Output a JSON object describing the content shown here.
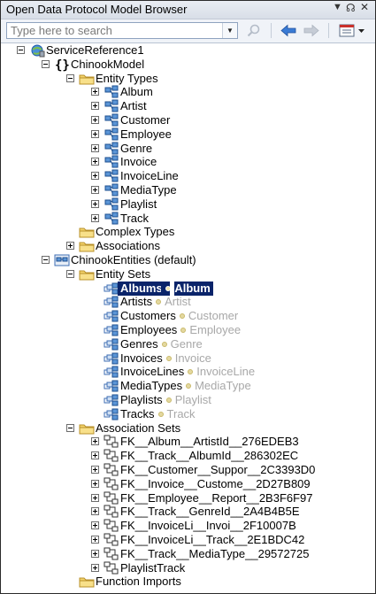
{
  "window": {
    "title": "Open Data Protocol Model Browser"
  },
  "toolbar": {
    "search_placeholder": "Type here to search"
  },
  "tree": [
    {
      "label": "ServiceReference1",
      "icon": "service-reference-icon",
      "level": 0,
      "expander": "minus"
    },
    {
      "label": "ChinookModel",
      "icon": "namespace-braces-icon",
      "level": 1,
      "expander": "minus"
    },
    {
      "label": "Entity Types",
      "icon": "folder-icon",
      "level": 2,
      "expander": "minus"
    },
    {
      "label": "Album",
      "icon": "entity-type-icon",
      "level": 3,
      "expander": "plus"
    },
    {
      "label": "Artist",
      "icon": "entity-type-icon",
      "level": 3,
      "expander": "plus"
    },
    {
      "label": "Customer",
      "icon": "entity-type-icon",
      "level": 3,
      "expander": "plus"
    },
    {
      "label": "Employee",
      "icon": "entity-type-icon",
      "level": 3,
      "expander": "plus"
    },
    {
      "label": "Genre",
      "icon": "entity-type-icon",
      "level": 3,
      "expander": "plus"
    },
    {
      "label": "Invoice",
      "icon": "entity-type-icon",
      "level": 3,
      "expander": "plus"
    },
    {
      "label": "InvoiceLine",
      "icon": "entity-type-icon",
      "level": 3,
      "expander": "plus"
    },
    {
      "label": "MediaType",
      "icon": "entity-type-icon",
      "level": 3,
      "expander": "plus"
    },
    {
      "label": "Playlist",
      "icon": "entity-type-icon",
      "level": 3,
      "expander": "plus"
    },
    {
      "label": "Track",
      "icon": "entity-type-icon",
      "level": 3,
      "expander": "plus"
    },
    {
      "label": "Complex Types",
      "icon": "folder-icon",
      "level": 2,
      "expander": "none"
    },
    {
      "label": "Associations",
      "icon": "folder-icon",
      "level": 2,
      "expander": "plus"
    },
    {
      "label": "ChinookEntities (default)",
      "icon": "entity-container-icon",
      "level": 1,
      "expander": "minus"
    },
    {
      "label": "Entity Sets",
      "icon": "folder-icon",
      "level": 2,
      "expander": "minus"
    },
    {
      "label": "Albums",
      "type": "Album",
      "icon": "entity-set-icon",
      "level": 3,
      "expander": "none",
      "selected": true
    },
    {
      "label": "Artists",
      "type": "Artist",
      "icon": "entity-set-icon",
      "level": 3,
      "expander": "none"
    },
    {
      "label": "Customers",
      "type": "Customer",
      "icon": "entity-set-icon",
      "level": 3,
      "expander": "none"
    },
    {
      "label": "Employees",
      "type": "Employee",
      "icon": "entity-set-icon",
      "level": 3,
      "expander": "none"
    },
    {
      "label": "Genres",
      "type": "Genre",
      "icon": "entity-set-icon",
      "level": 3,
      "expander": "none"
    },
    {
      "label": "Invoices",
      "type": "Invoice",
      "icon": "entity-set-icon",
      "level": 3,
      "expander": "none"
    },
    {
      "label": "InvoiceLines",
      "type": "InvoiceLine",
      "icon": "entity-set-icon",
      "level": 3,
      "expander": "none"
    },
    {
      "label": "MediaTypes",
      "type": "MediaType",
      "icon": "entity-set-icon",
      "level": 3,
      "expander": "none"
    },
    {
      "label": "Playlists",
      "type": "Playlist",
      "icon": "entity-set-icon",
      "level": 3,
      "expander": "none"
    },
    {
      "label": "Tracks",
      "type": "Track",
      "icon": "entity-set-icon",
      "level": 3,
      "expander": "none"
    },
    {
      "label": "Association Sets",
      "icon": "folder-icon",
      "level": 2,
      "expander": "minus"
    },
    {
      "label": "FK__Album__ArtistId__276EDEB3",
      "icon": "association-set-icon",
      "level": 3,
      "expander": "plus"
    },
    {
      "label": "FK__Track__AlbumId__286302EC",
      "icon": "association-set-icon",
      "level": 3,
      "expander": "plus"
    },
    {
      "label": "FK__Customer__Suppor__2C3393D0",
      "icon": "association-set-icon",
      "level": 3,
      "expander": "plus"
    },
    {
      "label": "FK__Invoice__Custome__2D27B809",
      "icon": "association-set-icon",
      "level": 3,
      "expander": "plus"
    },
    {
      "label": "FK__Employee__Report__2B3F6F97",
      "icon": "association-set-icon",
      "level": 3,
      "expander": "plus"
    },
    {
      "label": "FK__Track__GenreId__2A4B4B5E",
      "icon": "association-set-icon",
      "level": 3,
      "expander": "plus"
    },
    {
      "label": "FK__InvoiceLi__Invoi__2F10007B",
      "icon": "association-set-icon",
      "level": 3,
      "expander": "plus"
    },
    {
      "label": "FK__InvoiceLi__Track__2E1BDC42",
      "icon": "association-set-icon",
      "level": 3,
      "expander": "plus"
    },
    {
      "label": "FK__Track__MediaType__29572725",
      "icon": "association-set-icon",
      "level": 3,
      "expander": "plus"
    },
    {
      "label": "PlaylistTrack",
      "icon": "association-set-icon",
      "level": 3,
      "expander": "plus"
    },
    {
      "label": "Function Imports",
      "icon": "folder-icon",
      "level": 2,
      "expander": "none"
    }
  ],
  "colors": {
    "selection": "#0a246a",
    "type_text": "#a8a8a8",
    "accent": "#3a7bd5"
  }
}
